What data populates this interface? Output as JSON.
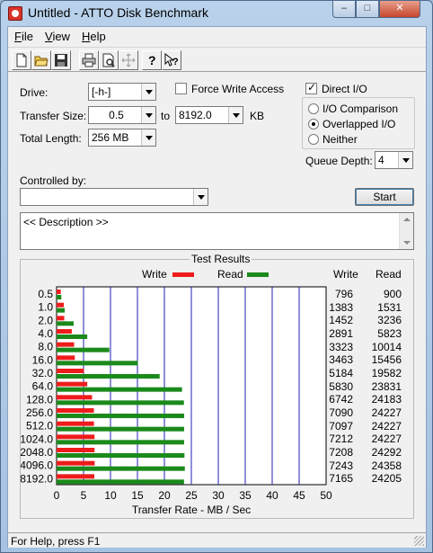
{
  "window": {
    "title": "Untitled - ATTO Disk Benchmark"
  },
  "menu": [
    {
      "accel": "F",
      "rest": "ile"
    },
    {
      "accel": "V",
      "rest": "iew"
    },
    {
      "accel": "H",
      "rest": "elp"
    }
  ],
  "toolbar": {
    "icons": [
      "new-document-icon",
      "open-folder-icon",
      "save-icon",
      "print-icon",
      "print-preview-icon",
      "move-icon",
      "help-icon",
      "context-help-icon"
    ]
  },
  "form": {
    "drive_label": "Drive:",
    "drive_value": "[-h-]",
    "transfer_size_label": "Transfer Size:",
    "transfer_from": "0.5",
    "transfer_to_label": "to",
    "transfer_to": "8192.0",
    "transfer_unit": "KB",
    "total_length_label": "Total Length:",
    "total_length_value": "256 MB",
    "force_write_label": "Force Write Access",
    "force_write_checked": false,
    "direct_io_label": "Direct I/O",
    "direct_io_checked": true,
    "io_comparison_label": "I/O Comparison",
    "overlapped_io_label": "Overlapped I/O",
    "neither_label": "Neither",
    "selected_io_mode": "Overlapped I/O",
    "queue_depth_label": "Queue Depth:",
    "queue_depth_value": "4",
    "controlled_by_label": "Controlled by:",
    "controlled_by_value": "",
    "start_label": "Start",
    "description_text": "<< Description >>"
  },
  "results": {
    "group_title": "Test Results",
    "legend_write": "Write",
    "legend_read": "Read",
    "col_write": "Write",
    "col_read": "Read",
    "rows": [
      {
        "size": "0.5",
        "write": "796",
        "read": "900"
      },
      {
        "size": "1.0",
        "write": "1383",
        "read": "1531"
      },
      {
        "size": "2.0",
        "write": "1452",
        "read": "3236"
      },
      {
        "size": "4.0",
        "write": "2891",
        "read": "5823"
      },
      {
        "size": "8.0",
        "write": "3323",
        "read": "10014"
      },
      {
        "size": "16.0",
        "write": "3463",
        "read": "15456"
      },
      {
        "size": "32.0",
        "write": "5184",
        "read": "19582"
      },
      {
        "size": "64.0",
        "write": "5830",
        "read": "23831"
      },
      {
        "size": "128.0",
        "write": "6742",
        "read": "24183"
      },
      {
        "size": "256.0",
        "write": "7090",
        "read": "24227"
      },
      {
        "size": "512.0",
        "write": "7097",
        "read": "24227"
      },
      {
        "size": "1024.0",
        "write": "7212",
        "read": "24227"
      },
      {
        "size": "2048.0",
        "write": "7208",
        "read": "24292"
      },
      {
        "size": "4096.0",
        "write": "7243",
        "read": "24358"
      },
      {
        "size": "8192.0",
        "write": "7165",
        "read": "24205"
      }
    ],
    "x_ticks": [
      "0",
      "5",
      "10",
      "15",
      "20",
      "25",
      "30",
      "35",
      "40",
      "45",
      "50"
    ],
    "x_label": "Transfer Rate - MB / Sec",
    "write_color": "#ee1c1c",
    "read_color": "#1a8a1a",
    "grid_color": "#1f1fb4"
  },
  "chart_data": {
    "type": "bar",
    "categories": [
      "0.5",
      "1.0",
      "2.0",
      "4.0",
      "8.0",
      "16.0",
      "32.0",
      "64.0",
      "128.0",
      "256.0",
      "512.0",
      "1024.0",
      "2048.0",
      "4096.0",
      "8192.0"
    ],
    "series": [
      {
        "name": "Write",
        "values": [
          0.78,
          1.35,
          1.42,
          2.82,
          3.25,
          3.38,
          5.06,
          5.69,
          6.58,
          6.92,
          6.93,
          7.04,
          7.04,
          7.07,
          7.0
        ]
      },
      {
        "name": "Read",
        "values": [
          0.88,
          1.5,
          3.16,
          5.69,
          9.78,
          15.09,
          19.12,
          23.27,
          23.62,
          23.66,
          23.66,
          23.66,
          23.72,
          23.79,
          23.64
        ]
      }
    ],
    "xlabel": "Transfer Rate - MB / Sec",
    "xlim": [
      0,
      50
    ],
    "orientation": "horizontal",
    "legend": "top"
  },
  "status": {
    "text": "For Help, press F1"
  }
}
